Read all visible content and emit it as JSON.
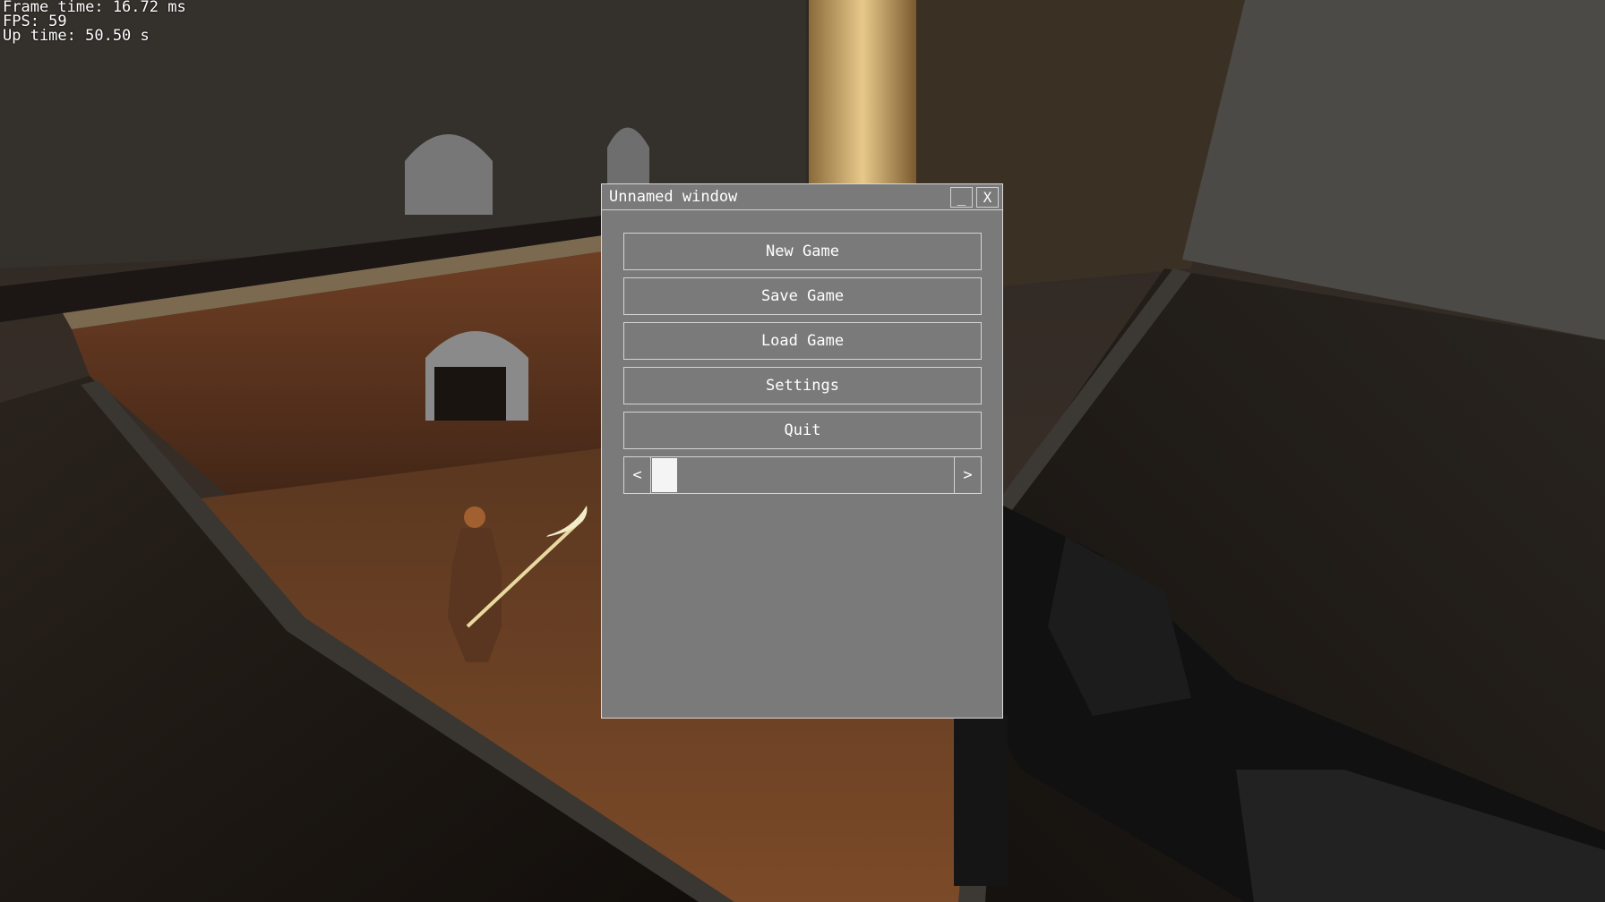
{
  "hud": {
    "frame_time": "Frame time: 16.72 ms",
    "fps": "FPS: 59",
    "up_time": "Up time: 50.50 s"
  },
  "window": {
    "title": "Unnamed window",
    "minimize_label": "_",
    "close_label": "X",
    "buttons": [
      "New Game",
      "Save Game",
      "Load Game",
      "Settings",
      "Quit"
    ],
    "scrollbar": {
      "left_label": "<",
      "right_label": ">",
      "position": 0.0
    }
  },
  "colors": {
    "panel": "#7a7a7a",
    "border": "#d4d4d4",
    "text": "#ffffff"
  }
}
